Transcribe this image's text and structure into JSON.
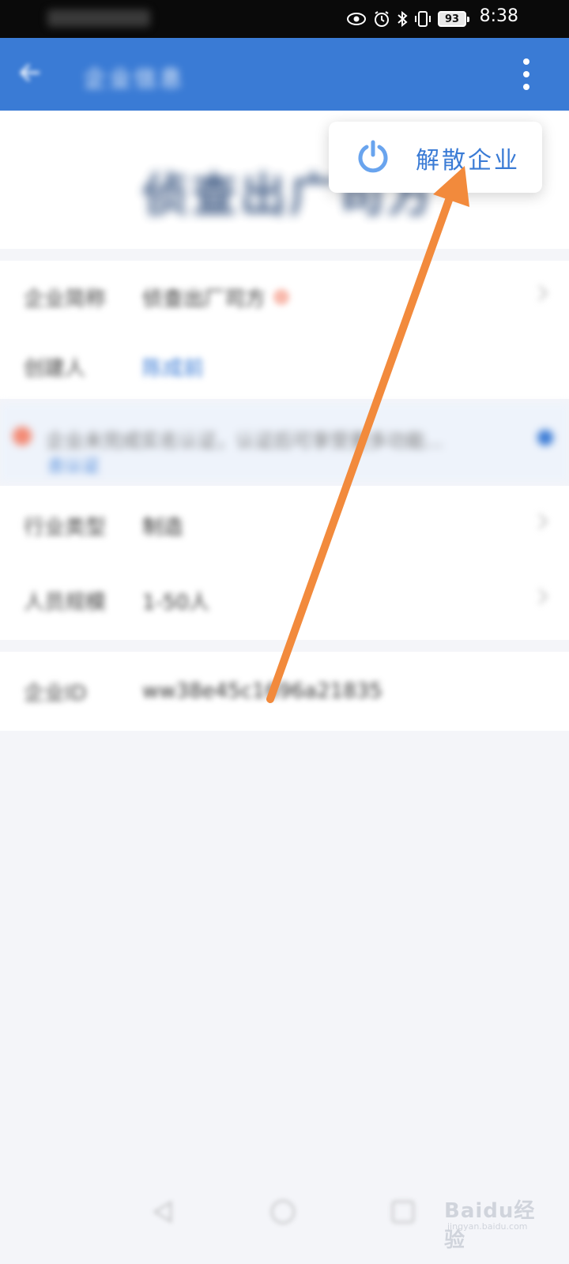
{
  "status_bar": {
    "battery": "93",
    "time": "8:38",
    "icons": [
      "eye-icon",
      "alarm-icon",
      "bluetooth-icon",
      "vibrate-icon",
      "battery-icon"
    ]
  },
  "app_bar": {
    "title": "企业信息",
    "menu_icon": "more-vertical-icon"
  },
  "company": {
    "name": "侦查出广司方"
  },
  "details": {
    "rows": [
      {
        "label": "企业简称",
        "value": "侦查出厂司方"
      },
      {
        "label": "创建人",
        "value": "陈成前"
      }
    ]
  },
  "notice": {
    "text": "企业未完成实名认证，认证后可享受更多功能...",
    "more": "去认证"
  },
  "settings": {
    "rows": [
      {
        "label": "行业类型",
        "value": "制造"
      },
      {
        "label": "人员规模",
        "value": "1-50人"
      }
    ]
  },
  "enterprise_id": {
    "label": "企业ID",
    "value": "ww38e45c1696a21835"
  },
  "popup_menu": {
    "items": [
      {
        "label": "解散企业",
        "icon": "power-icon"
      }
    ]
  },
  "annotation": {
    "color": "#f28a3c"
  },
  "watermark": {
    "brand": "Baidu经验",
    "sub": "jingyan.baidu.com"
  },
  "colors": {
    "primary": "#3a7bd5",
    "background": "#f4f5f9"
  }
}
